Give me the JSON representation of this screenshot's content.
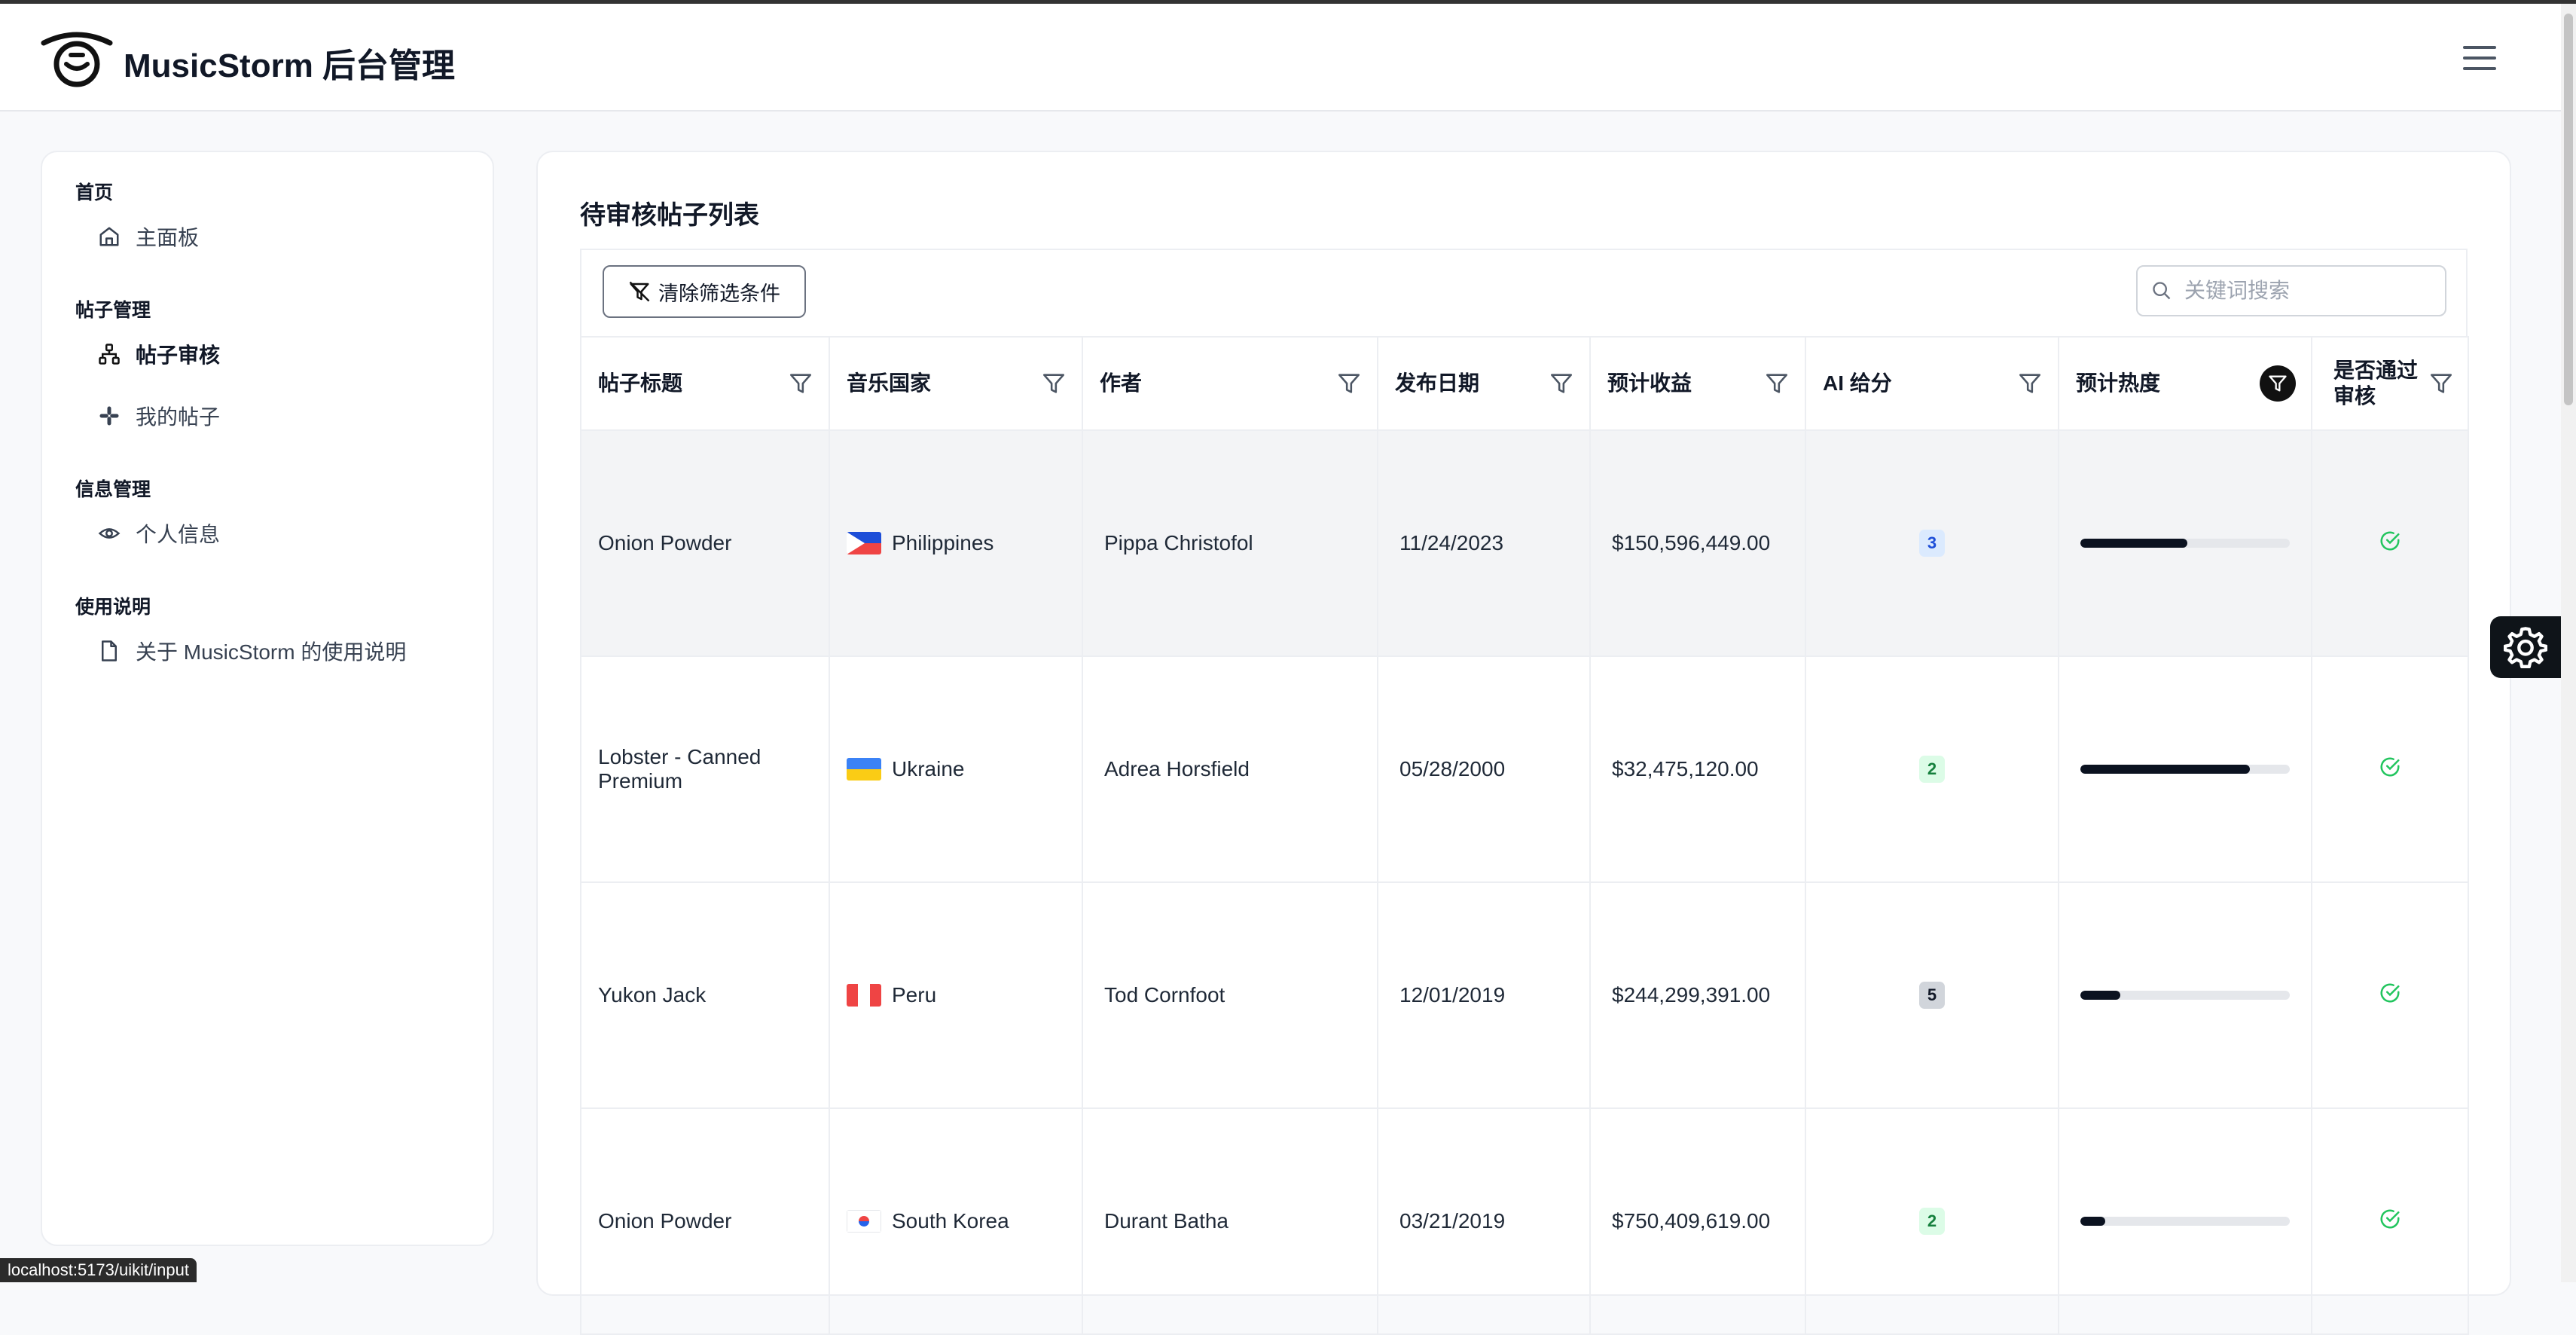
{
  "app": {
    "title": "MusicStorm 后台管理"
  },
  "sidebar": {
    "sections": [
      {
        "title": "首页",
        "items": [
          {
            "label": "主面板",
            "icon": "home-icon"
          }
        ]
      },
      {
        "title": "帖子管理",
        "items": [
          {
            "label": "帖子审核",
            "icon": "network-icon",
            "active": true
          },
          {
            "label": "我的帖子",
            "icon": "slack-icon"
          }
        ]
      },
      {
        "title": "信息管理",
        "items": [
          {
            "label": "个人信息",
            "icon": "eye-icon"
          }
        ]
      },
      {
        "title": "使用说明",
        "items": [
          {
            "label": "关于 MusicStorm 的使用说明",
            "icon": "file-icon"
          }
        ]
      }
    ]
  },
  "main": {
    "title": "待审核帖子列表",
    "clear_filters_label": "清除筛选条件",
    "search_placeholder": "关键词搜索"
  },
  "table": {
    "columns": [
      "帖子标题",
      "音乐国家",
      "作者",
      "发布日期",
      "预计收益",
      "AI 给分",
      "预计热度",
      "是否通过审核"
    ],
    "rows": [
      {
        "title": "Onion Powder",
        "country": "Philippines",
        "flag": "philippines",
        "author": "Pippa Christofol",
        "date": "11/24/2023",
        "revenue": "$150,596,449.00",
        "ai_score": "3",
        "heat": 0.51,
        "approved": true
      },
      {
        "title": "Lobster - Canned Premium",
        "country": "Ukraine",
        "flag": "ukraine",
        "author": "Adrea Horsfield",
        "date": "05/28/2000",
        "revenue": "$32,475,120.00",
        "ai_score": "2",
        "heat": 0.81,
        "approved": true
      },
      {
        "title": "Yukon Jack",
        "country": "Peru",
        "flag": "peru",
        "author": "Tod Cornfoot",
        "date": "12/01/2019",
        "revenue": "$244,299,391.00",
        "ai_score": "5",
        "heat": 0.19,
        "approved": true
      },
      {
        "title": "Onion Powder",
        "country": "South Korea",
        "flag": "south-korea",
        "author": "Durant Batha",
        "date": "03/21/2019",
        "revenue": "$750,409,619.00",
        "ai_score": "2",
        "heat": 0.12,
        "approved": true
      }
    ]
  },
  "colors": {
    "score_2": "#dcfce7",
    "score_3": "#dbeafe",
    "score_5": "#d1d5db",
    "approved": "#22c55e",
    "heat_fill": "#0b1220"
  },
  "status": {
    "url": "localhost:5173/uikit/input"
  }
}
